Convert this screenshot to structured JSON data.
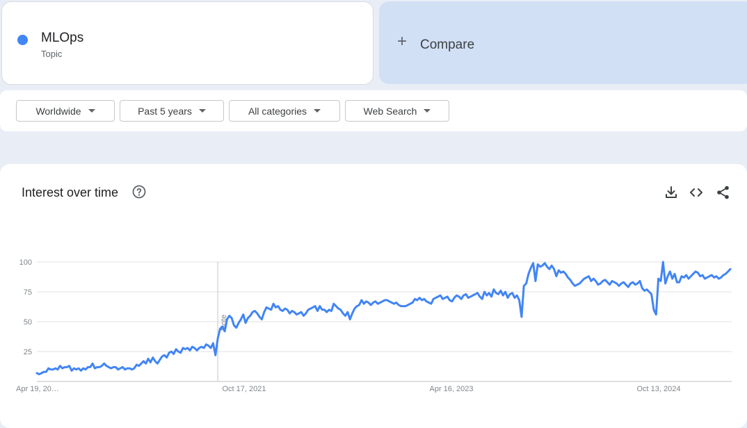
{
  "term": {
    "name": "MLOps",
    "type": "Topic",
    "color": "#4285f4"
  },
  "compare": {
    "label": "Compare"
  },
  "filters": [
    {
      "label": "Worldwide"
    },
    {
      "label": "Past 5 years"
    },
    {
      "label": "All categories"
    },
    {
      "label": "Web Search"
    }
  ],
  "panel": {
    "title": "Interest over time",
    "icons": [
      "help-icon",
      "download-icon",
      "embed-icon",
      "share-icon"
    ]
  },
  "chart_data": {
    "type": "line",
    "ylim": [
      0,
      100
    ],
    "yticks": [
      25,
      50,
      75,
      100
    ],
    "x_tick_labels": [
      "Apr 19, 20…",
      "Oct 17, 2021",
      "Apr 16, 2023",
      "Oct 13, 2024"
    ],
    "annotation": {
      "text": "Note",
      "at_week": 78
    },
    "grid": true,
    "series": [
      {
        "color": "#4285f4",
        "values": [
          7,
          6,
          7,
          8,
          8,
          11,
          10,
          10,
          11,
          10,
          13,
          11,
          12,
          12,
          13,
          9,
          11,
          10,
          11,
          9,
          11,
          10,
          12,
          12,
          15,
          11,
          12,
          12,
          13,
          15,
          13,
          12,
          11,
          12,
          12,
          10,
          11,
          12,
          10,
          11,
          11,
          10,
          11,
          14,
          13,
          15,
          17,
          15,
          19,
          16,
          20,
          17,
          15,
          18,
          21,
          22,
          20,
          24,
          25,
          23,
          27,
          25,
          24,
          28,
          27,
          28,
          26,
          29,
          28,
          26,
          28,
          29,
          28,
          31,
          30,
          28,
          32,
          22,
          36,
          44,
          46,
          42,
          52,
          55,
          53,
          47,
          45,
          49,
          52,
          56,
          49,
          53,
          55,
          58,
          59,
          57,
          54,
          52,
          58,
          62,
          61,
          60,
          65,
          62,
          63,
          60,
          59,
          61,
          60,
          57,
          59,
          58,
          56,
          57,
          58,
          55,
          57,
          60,
          61,
          62,
          63,
          59,
          63,
          60,
          60,
          58,
          60,
          59,
          65,
          63,
          61,
          60,
          57,
          55,
          58,
          52,
          57,
          61,
          63,
          64,
          68,
          65,
          67,
          66,
          64,
          66,
          67,
          65,
          66,
          67,
          68,
          68,
          67,
          66,
          65,
          66,
          64,
          63,
          63,
          63,
          64,
          65,
          66,
          69,
          68,
          70,
          68,
          69,
          67,
          66,
          65,
          69,
          70,
          71,
          72,
          69,
          70,
          71,
          68,
          67,
          70,
          72,
          71,
          69,
          72,
          73,
          70,
          71,
          72,
          73,
          74,
          71,
          69,
          75,
          72,
          74,
          71,
          77,
          74,
          73,
          76,
          72,
          75,
          70,
          73,
          74,
          70,
          72,
          68,
          54,
          80,
          82,
          90,
          95,
          99,
          84,
          98,
          96,
          97,
          99,
          96,
          94,
          97,
          94,
          88,
          93,
          91,
          92,
          90,
          87,
          85,
          82,
          80,
          81,
          82,
          84,
          86,
          87,
          88,
          84,
          86,
          84,
          81,
          82,
          84,
          85,
          83,
          81,
          84,
          83,
          82,
          80,
          82,
          83,
          81,
          79,
          82,
          83,
          81,
          82,
          84,
          78,
          76,
          77,
          75,
          73,
          60,
          56,
          86,
          84,
          100,
          82,
          88,
          92,
          86,
          90,
          83,
          83,
          88,
          87,
          89,
          86,
          88,
          90,
          92,
          91,
          88,
          89,
          86,
          87,
          88,
          89,
          87,
          88,
          86,
          87,
          89,
          90,
          92,
          94
        ]
      }
    ]
  }
}
